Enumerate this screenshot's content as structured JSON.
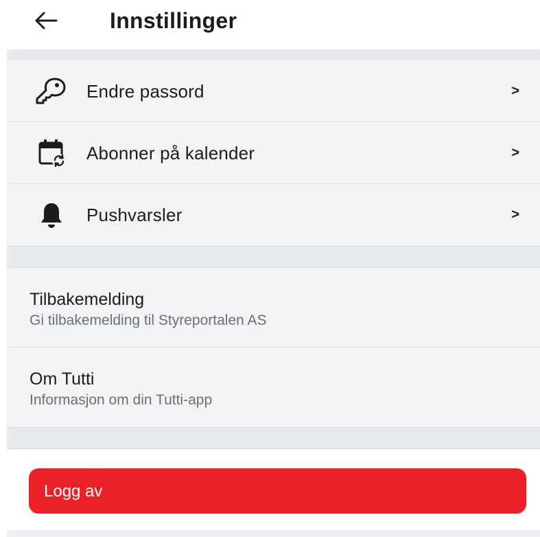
{
  "header": {
    "title": "Innstillinger",
    "back_icon": "arrow-left-icon"
  },
  "account_group": {
    "items": [
      {
        "label": "Endre passord",
        "icon": "key-icon"
      },
      {
        "label": "Abonner på kalender",
        "icon": "calendar-sync-icon"
      },
      {
        "label": "Pushvarsler",
        "icon": "bell-icon"
      }
    ],
    "chevron": ">"
  },
  "info_group": {
    "items": [
      {
        "title": "Tilbakemelding",
        "subtitle": "Gi tilbakemelding til Styreportalen AS"
      },
      {
        "title": "Om Tutti",
        "subtitle": "Informasjon om din Tutti-app"
      }
    ]
  },
  "logout": {
    "label": "Logg av",
    "color": "#ec2127"
  }
}
